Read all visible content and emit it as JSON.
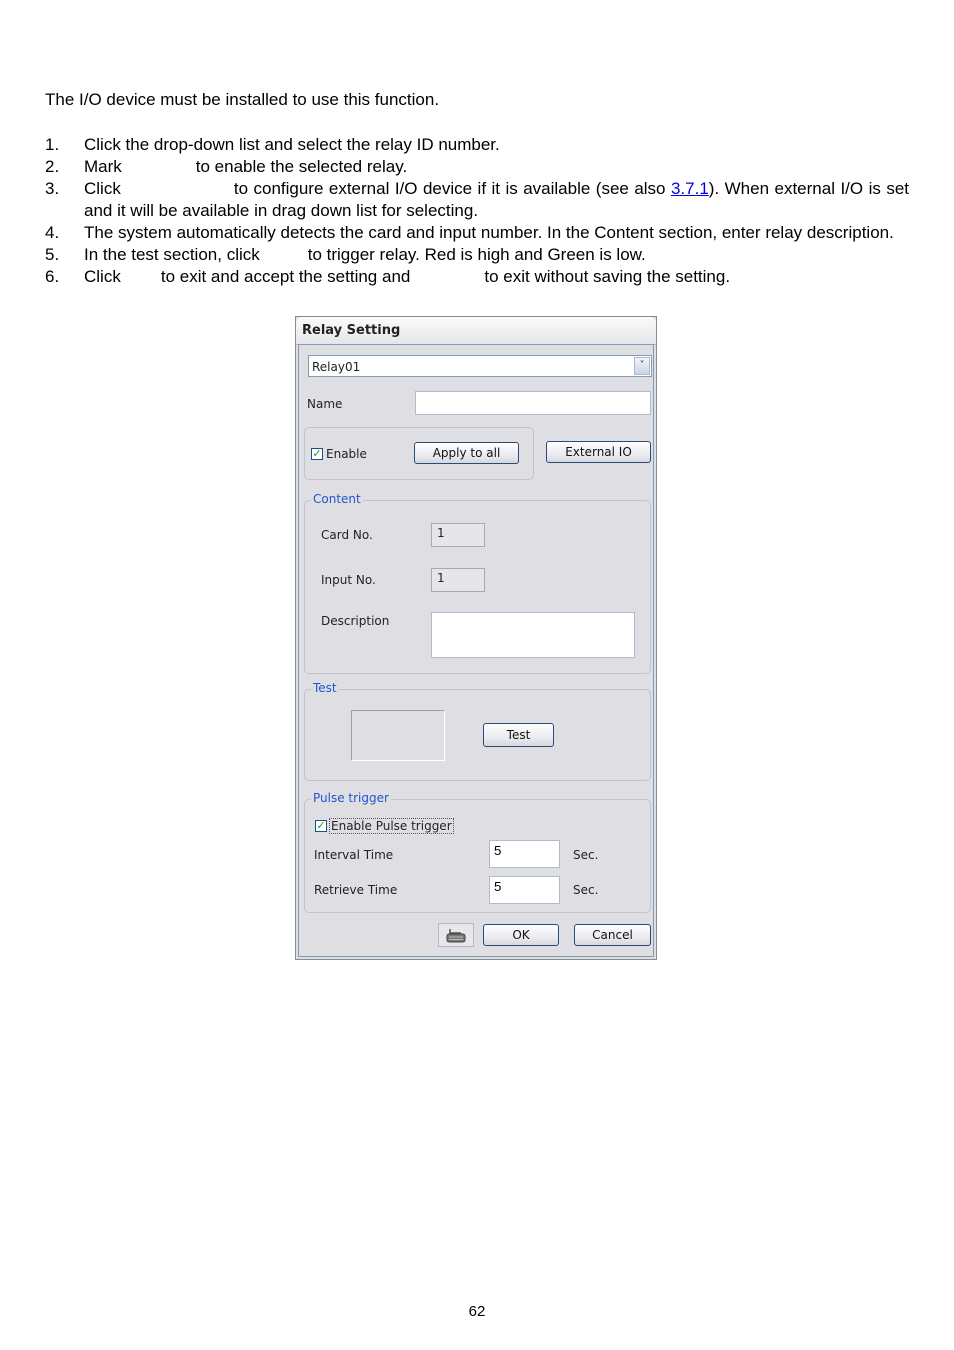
{
  "intro": "The I/O device must be installed to use this function.",
  "steps": [
    {
      "num": "1.",
      "text": "Click the drop-down list and select the relay ID number."
    },
    {
      "num": "2.",
      "pre": "Mark",
      "post": "to enable the selected relay."
    },
    {
      "num": "3.",
      "pre": "Click",
      "post": "to configure external I/O device if it is available (see also ",
      "link": "3.7.1",
      "tail": "). When external I/O is set and it will be available in drag down list for selecting."
    },
    {
      "num": "4.",
      "text": "The system automatically detects the card and input number. In the Content section, enter relay description."
    },
    {
      "num": "5.",
      "pre": "In the test section, click",
      "post": "to trigger relay. Red is high and Green is low."
    },
    {
      "num": "6.",
      "pre": "Click",
      "mid": "to exit and accept the setting and",
      "post": "to exit without saving the setting."
    }
  ],
  "dialog": {
    "title": "Relay Setting",
    "relay_select": {
      "value": "Relay01",
      "icon": "chevron-down-icon"
    },
    "name": {
      "label": "Name",
      "value": ""
    },
    "enable": {
      "label": "Enable",
      "checked": true
    },
    "apply_to_all": "Apply to all",
    "external_io": "External IO",
    "content": {
      "legend": "Content",
      "card_no": {
        "label": "Card No.",
        "value": "1"
      },
      "input_no": {
        "label": "Input No.",
        "value": "1"
      },
      "description": {
        "label": "Description",
        "value": ""
      }
    },
    "test": {
      "legend": "Test",
      "button": "Test"
    },
    "pulse": {
      "legend": "Pulse trigger",
      "enable": {
        "label": "Enable Pulse trigger",
        "checked": true
      },
      "interval": {
        "label": "Interval Time",
        "value": "5",
        "unit": "Sec."
      },
      "retrieve": {
        "label": "Retrieve Time",
        "value": "5",
        "unit": "Sec."
      }
    },
    "keyboard_icon": "keyboard-icon",
    "ok": "OK",
    "cancel": "Cancel"
  },
  "page_number": "62"
}
